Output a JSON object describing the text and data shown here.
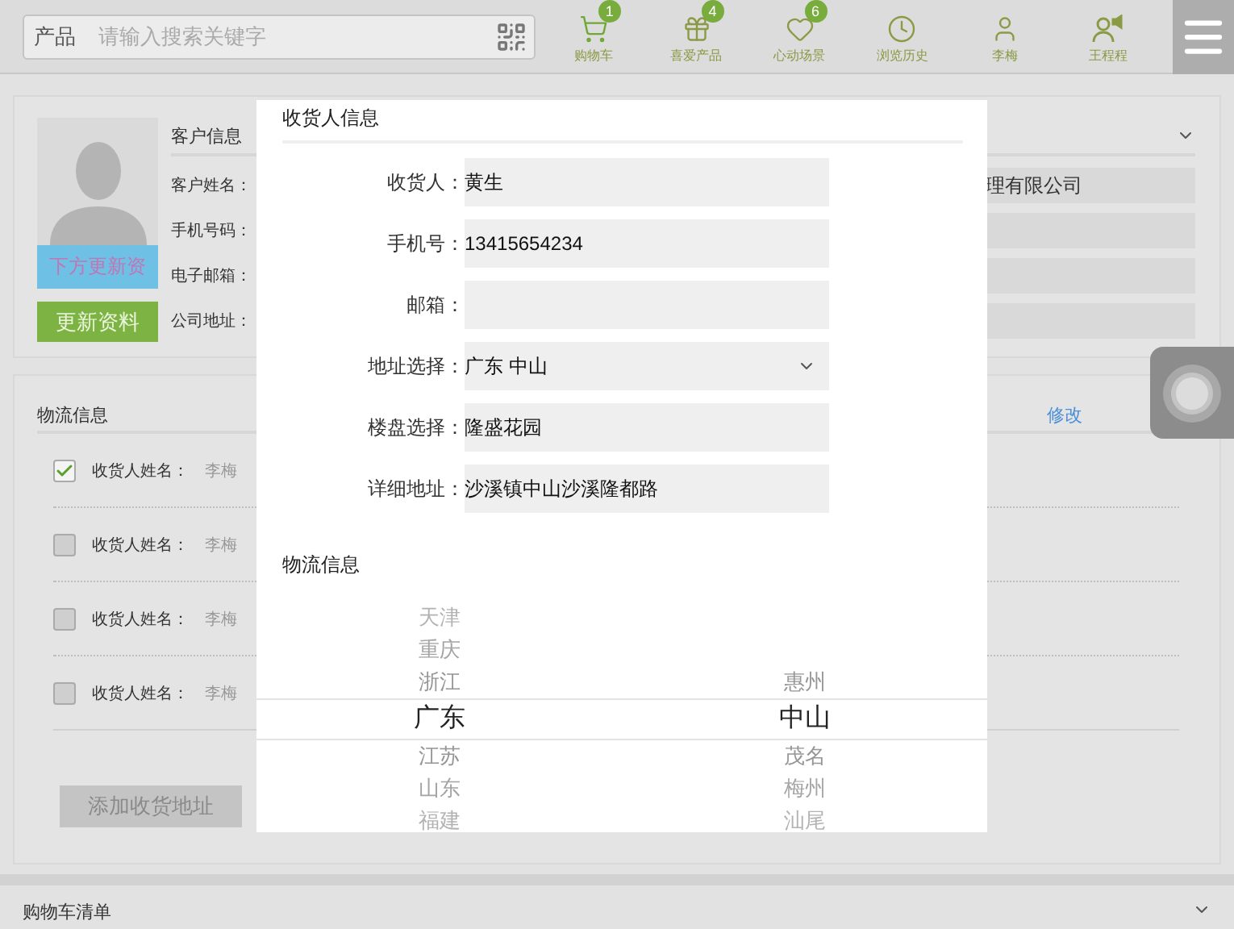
{
  "search": {
    "category": "产品",
    "placeholder": "请输入搜索关键字"
  },
  "nav": [
    {
      "label": "购物车",
      "badge": "1",
      "kind": "cart"
    },
    {
      "label": "喜爱产品",
      "badge": "4",
      "kind": "gift"
    },
    {
      "label": "心动场景",
      "badge": "6",
      "kind": "heart"
    },
    {
      "label": "浏览历史",
      "kind": "clock"
    },
    {
      "label": "李梅",
      "kind": "person"
    },
    {
      "label": "王程程",
      "kind": "speaker"
    }
  ],
  "customer": {
    "title": "客户信息",
    "photo_caption": "下方更新资",
    "update_button": "更新资料",
    "rows": [
      {
        "label": "客户姓名：",
        "value": "理有限公司"
      },
      {
        "label": "手机号码："
      },
      {
        "label": "电子邮箱："
      },
      {
        "label": "公司地址："
      }
    ]
  },
  "logistics": {
    "title": "物流信息",
    "edit_link": "修改",
    "addresses": [
      {
        "label": "收货人姓名：",
        "name": "李梅",
        "checked": true
      },
      {
        "label": "收货人姓名：",
        "name": "李梅",
        "checked": false
      },
      {
        "label": "收货人姓名：",
        "name": "李梅",
        "checked": false
      },
      {
        "label": "收货人姓名：",
        "name": "李梅",
        "checked": false
      }
    ],
    "add_button": "添加收货地址"
  },
  "modal": {
    "title": "收货人信息",
    "fields": [
      {
        "label": "收货人：",
        "value": "黄生",
        "kind": "text"
      },
      {
        "label": "手机号：",
        "value": "13415654234",
        "kind": "text"
      },
      {
        "label": "邮箱：",
        "kind": "text"
      },
      {
        "label": "地址选择：",
        "value": "广东 中山",
        "kind": "select"
      },
      {
        "label": "楼盘选择：",
        "value": "隆盛花园",
        "kind": "text"
      },
      {
        "label": "详细地址：",
        "value": "沙溪镇中山沙溪隆都路",
        "kind": "text"
      }
    ],
    "section": "物流信息",
    "picker": [
      {
        "items": [
          {
            "text": "天津",
            "selected": false
          },
          {
            "text": "重庆",
            "selected": false
          },
          {
            "text": "浙江",
            "selected": false
          },
          {
            "text": "广东",
            "selected": true
          },
          {
            "text": "江苏",
            "selected": false
          },
          {
            "text": "山东",
            "selected": false
          },
          {
            "text": "福建",
            "selected": false
          }
        ]
      },
      {
        "items": [
          {
            "text": "惠州",
            "selected": false
          },
          {
            "text": "中山",
            "selected": true
          },
          {
            "text": "茂名",
            "selected": false
          },
          {
            "text": "梅州",
            "selected": false
          },
          {
            "text": "汕尾",
            "selected": false
          }
        ]
      }
    ]
  },
  "cart_section": {
    "title": "购物车清单"
  }
}
